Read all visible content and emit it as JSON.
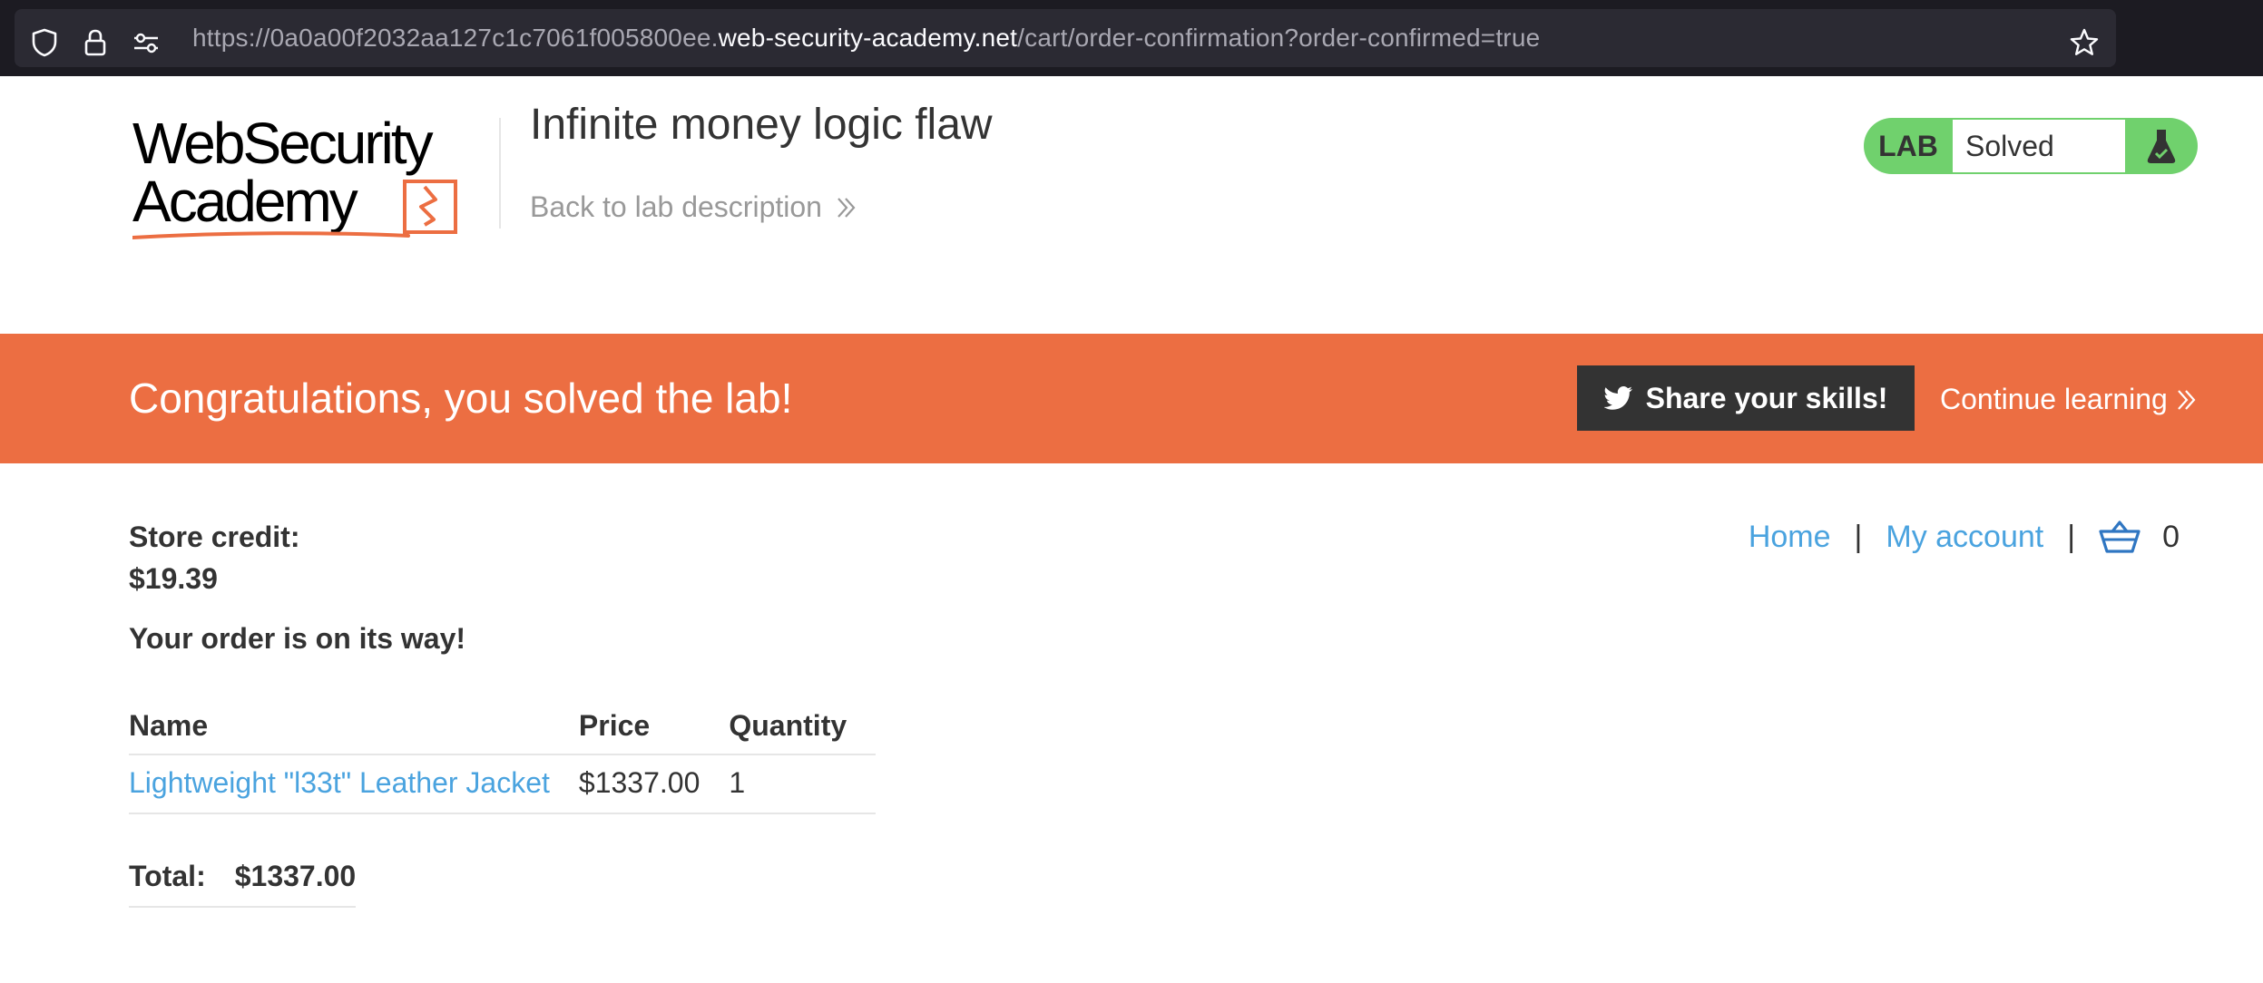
{
  "browser": {
    "url_prefix": "https://0a0a00f2032aa127c1c7061f005800ee.",
    "url_domain": "web-security-academy.net",
    "url_path": "/cart/order-confirmation?order-confirmed=true"
  },
  "header": {
    "logo_line1": "WebSecurity",
    "logo_line2": "Academy",
    "lab_title": "Infinite money logic flaw",
    "back_link": "Back to lab description",
    "lab_label": "LAB",
    "lab_status": "Solved"
  },
  "banner": {
    "message": "Congratulations, you solved the lab!",
    "share_button": "Share your skills!",
    "continue_link": "Continue learning"
  },
  "nav": {
    "home": "Home",
    "separator": "|",
    "my_account": "My account",
    "cart_count": "0"
  },
  "account": {
    "store_credit_label": "Store credit:",
    "store_credit_value": "$19.39"
  },
  "order": {
    "message": "Your order is on its way!",
    "columns": [
      "Name",
      "Price",
      "Quantity"
    ],
    "rows": [
      {
        "name": "Lightweight \"l33t\" Leather Jacket",
        "price": "$1337.00",
        "quantity": "1"
      }
    ],
    "total_label": "Total:",
    "total_value": "$1337.00"
  },
  "colors": {
    "banner": "#ec6e42",
    "link": "#4aa3df",
    "lab_badge": "#70d16d",
    "share_button": "#333333"
  },
  "icons": [
    "shield-icon",
    "lock-icon",
    "permissions-icon",
    "bookmark-star-icon",
    "chevron-double-right-icon",
    "flask-icon",
    "twitter-icon",
    "basket-icon"
  ]
}
